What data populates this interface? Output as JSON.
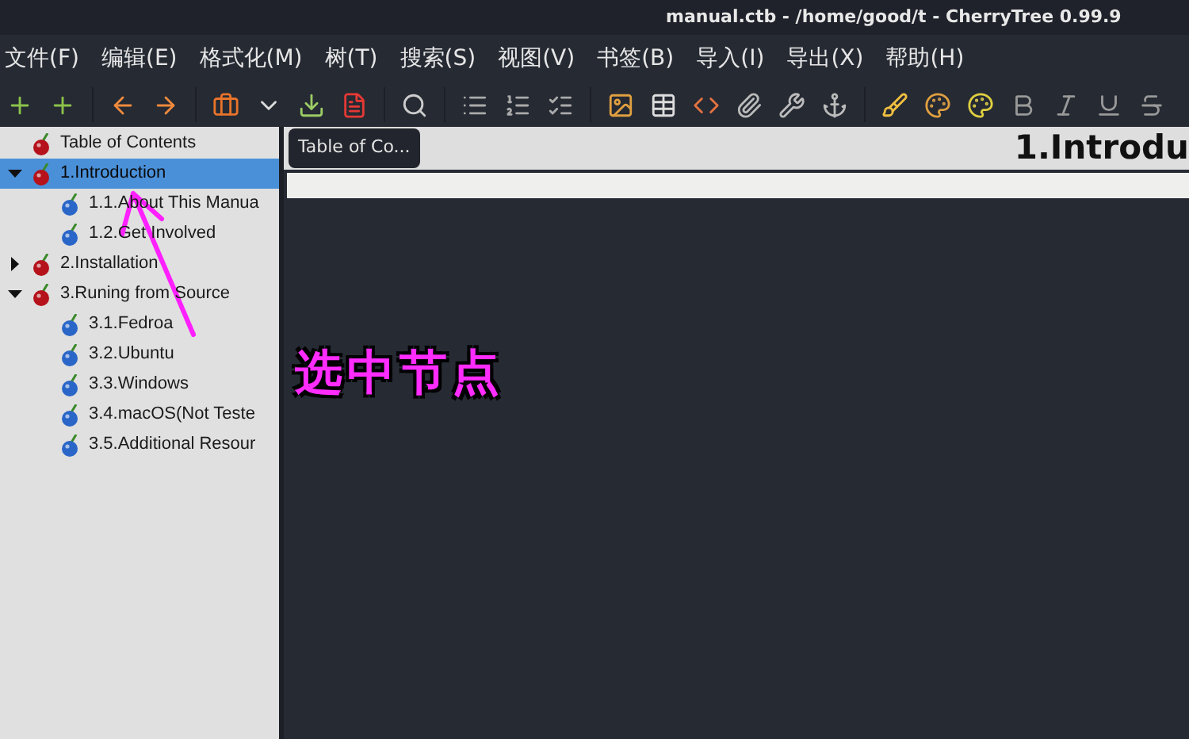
{
  "window": {
    "title": "manual.ctb - /home/good/t - CherryTree 0.99.9"
  },
  "menu": [
    "文件(F)",
    "编辑(E)",
    "格式化(M)",
    "树(T)",
    "搜索(S)",
    "视图(V)",
    "书签(B)",
    "导入(I)",
    "导出(X)",
    "帮助(H)"
  ],
  "tree": [
    {
      "label": "Table of Contents",
      "selected": false
    },
    {
      "label": "1.Introduction",
      "selected": true,
      "expanded": true,
      "children": [
        {
          "label": "1.1.About This Manua",
          "selected": false
        },
        {
          "label": "1.2.Get Involved",
          "selected": false
        }
      ]
    },
    {
      "label": "2.Installation",
      "selected": false,
      "expanded": false
    },
    {
      "label": "3.Runing from Source",
      "selected": false,
      "expanded": true,
      "children": [
        {
          "label": "3.1.Fedroa",
          "selected": false
        },
        {
          "label": "3.2.Ubuntu",
          "selected": false
        },
        {
          "label": "3.3.Windows",
          "selected": false
        },
        {
          "label": "3.4.macOS(Not Teste",
          "selected": false
        },
        {
          "label": "3.5.Additional Resour",
          "selected": false
        }
      ]
    }
  ],
  "breadcrumb": "Table of Co...",
  "node_title": "1.Introdu",
  "annotation": "选中节点"
}
